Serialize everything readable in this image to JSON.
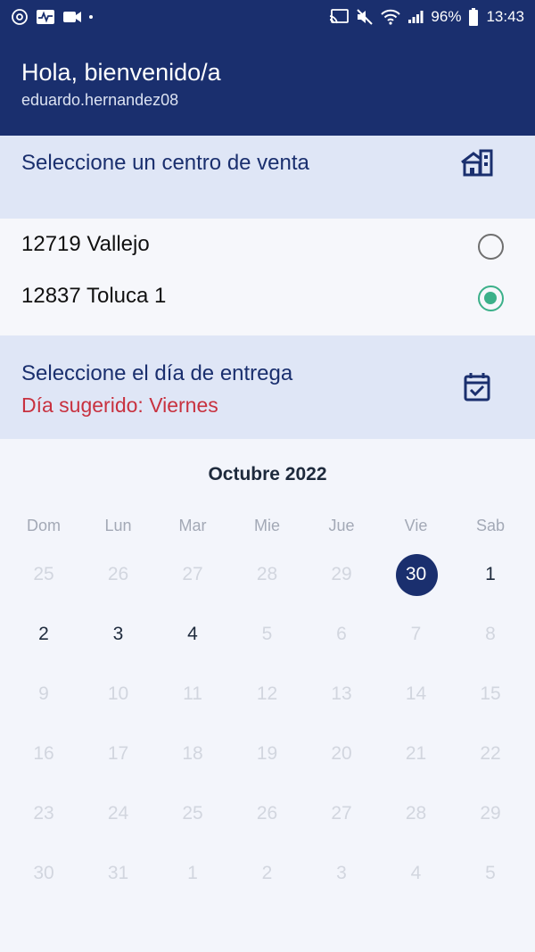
{
  "status_bar": {
    "left_icons": [
      "chromecast-icon",
      "activity-icon",
      "video-icon",
      "dot-icon"
    ],
    "right_icons": [
      "cast-icon",
      "mute-icon",
      "wifi-icon",
      "signal-icon"
    ],
    "battery": "96%",
    "time": "13:43"
  },
  "header": {
    "greeting": "Hola, bienvenido/a",
    "username": "eduardo.hernandez08"
  },
  "store_section": {
    "title": "Seleccione un centro de venta",
    "icon": "store-icon",
    "stores": [
      {
        "label": "12719 Vallejo",
        "selected": false
      },
      {
        "label": "12837 Toluca 1",
        "selected": true
      }
    ]
  },
  "delivery_section": {
    "title": "Seleccione el día de entrega",
    "suggested": "Día sugerido: Viernes",
    "icon": "calendar-check-icon"
  },
  "calendar": {
    "month": "Octubre 2022",
    "weekdays": [
      "Dom",
      "Lun",
      "Mar",
      "Mie",
      "Jue",
      "Vie",
      "Sab"
    ],
    "weeks": [
      [
        {
          "d": "25",
          "s": "disabled"
        },
        {
          "d": "26",
          "s": "disabled"
        },
        {
          "d": "27",
          "s": "disabled"
        },
        {
          "d": "28",
          "s": "disabled"
        },
        {
          "d": "29",
          "s": "disabled"
        },
        {
          "d": "30",
          "s": "selected"
        },
        {
          "d": "1",
          "s": "active"
        }
      ],
      [
        {
          "d": "2",
          "s": "active"
        },
        {
          "d": "3",
          "s": "active"
        },
        {
          "d": "4",
          "s": "active"
        },
        {
          "d": "5",
          "s": "disabled"
        },
        {
          "d": "6",
          "s": "disabled"
        },
        {
          "d": "7",
          "s": "disabled"
        },
        {
          "d": "8",
          "s": "disabled"
        }
      ],
      [
        {
          "d": "9",
          "s": "disabled"
        },
        {
          "d": "10",
          "s": "disabled"
        },
        {
          "d": "11",
          "s": "disabled"
        },
        {
          "d": "12",
          "s": "disabled"
        },
        {
          "d": "13",
          "s": "disabled"
        },
        {
          "d": "14",
          "s": "disabled"
        },
        {
          "d": "15",
          "s": "disabled"
        }
      ],
      [
        {
          "d": "16",
          "s": "disabled"
        },
        {
          "d": "17",
          "s": "disabled"
        },
        {
          "d": "18",
          "s": "disabled"
        },
        {
          "d": "19",
          "s": "disabled"
        },
        {
          "d": "20",
          "s": "disabled"
        },
        {
          "d": "21",
          "s": "disabled"
        },
        {
          "d": "22",
          "s": "disabled"
        }
      ],
      [
        {
          "d": "23",
          "s": "disabled"
        },
        {
          "d": "24",
          "s": "disabled"
        },
        {
          "d": "25",
          "s": "disabled"
        },
        {
          "d": "26",
          "s": "disabled"
        },
        {
          "d": "27",
          "s": "disabled"
        },
        {
          "d": "28",
          "s": "disabled"
        },
        {
          "d": "29",
          "s": "disabled"
        }
      ],
      [
        {
          "d": "30",
          "s": "disabled"
        },
        {
          "d": "31",
          "s": "disabled"
        },
        {
          "d": "1",
          "s": "disabled"
        },
        {
          "d": "2",
          "s": "disabled"
        },
        {
          "d": "3",
          "s": "disabled"
        },
        {
          "d": "4",
          "s": "disabled"
        },
        {
          "d": "5",
          "s": "disabled"
        }
      ]
    ]
  },
  "colors": {
    "primary": "#1a2f6e",
    "accent_radio": "#3bb089",
    "suggested_text": "#c8313f",
    "section_bg": "#dfe6f6"
  }
}
